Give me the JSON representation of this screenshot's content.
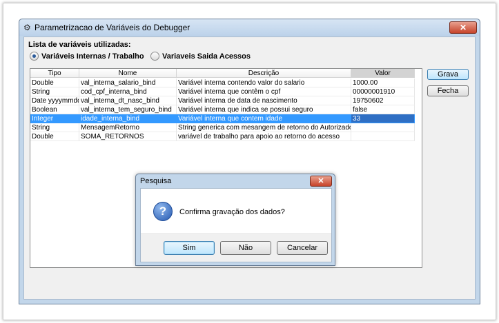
{
  "window": {
    "title": "Parametrizacao de Variáveis do Debugger",
    "close_label": "✕"
  },
  "lista_label": "Lista de variáveis utilizadas:",
  "radios": [
    {
      "label": "Variáveis Internas / Trabalho",
      "checked": true
    },
    {
      "label": "Variaveis Saida Acessos",
      "checked": false
    }
  ],
  "table": {
    "headers": [
      "Tipo",
      "Nome",
      "Descrição",
      "Valor"
    ],
    "rows": [
      [
        "Double",
        "val_interna_salario_bind",
        "Variável interna contendo valor do salario",
        "1000.00"
      ],
      [
        "String",
        "cod_cpf_interna_bind",
        "Variável interna que contêm o cpf",
        "00000001910"
      ],
      [
        "Date yyyymmdd",
        "val_interna_dt_nasc_bind",
        "Variável interna de data de nascimento",
        "19750602"
      ],
      [
        "Boolean",
        "val_interna_tem_seguro_bind",
        "Variável interna que indica se possui seguro",
        "false"
      ],
      [
        "Integer",
        "idade_interna_bind",
        "Variável interna que contem idade",
        "33"
      ],
      [
        "String",
        "MensagemRetorno",
        "String generica com mesangem de retorno do Autorizador",
        ""
      ],
      [
        "Double",
        "SOMA_RETORNOS",
        "variável de trabalho para apoio ao retorno do acesso",
        ""
      ]
    ],
    "selected_row": 4
  },
  "buttons": {
    "grava": "Grava",
    "fecha": "Fecha"
  },
  "dialog": {
    "title": "Pesquisa",
    "close_label": "✕",
    "icon": "question-icon",
    "message": "Confirma gravação dos dados?",
    "sim": "Sim",
    "nao": "Não",
    "cancelar": "Cancelar"
  }
}
